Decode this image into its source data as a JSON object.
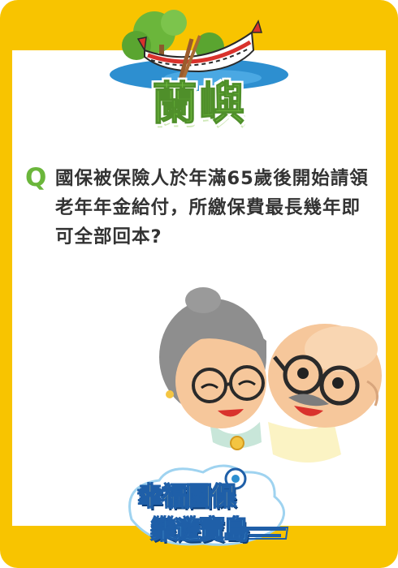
{
  "title": "蘭嶼",
  "question": {
    "label": "Q",
    "text": "國保被保險人於年滿65歲後開始請領老年年金給付，所繳保費最長幾年即可全部回本?"
  },
  "logo": {
    "line1": "幸福國保",
    "line2": "樂遊寶島"
  },
  "colors": {
    "frame": "#f8c400",
    "title_green": "#6bb63b",
    "text": "#333333",
    "logo_blue": "#1f5fa8"
  }
}
